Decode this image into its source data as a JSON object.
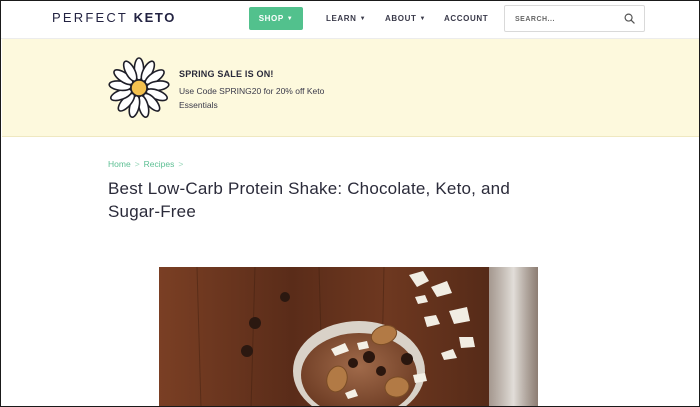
{
  "header": {
    "logo_light": "PERFECT ",
    "logo_bold": "KETO",
    "nav": {
      "shop": "SHOP",
      "learn": "LEARN",
      "about": "ABOUT",
      "account": "ACCOUNT"
    },
    "search": {
      "placeholder": "SEARCH..."
    },
    "shop_color": "#52c18d"
  },
  "banner": {
    "title": "SPRING SALE IS ON!",
    "text": "Use Code SPRING20 for 20% off Keto Essentials",
    "background": "#fdf9dd",
    "icon": "daisy-flower-icon"
  },
  "breadcrumb": {
    "items": [
      "Home",
      "Recipes"
    ],
    "separator": ">"
  },
  "article": {
    "title": "Best Low-Carb Protein Shake: Chocolate, Keto, and Sugar-Free"
  },
  "colors": {
    "accent": "#52c18d",
    "text": "#2b2b3a"
  }
}
